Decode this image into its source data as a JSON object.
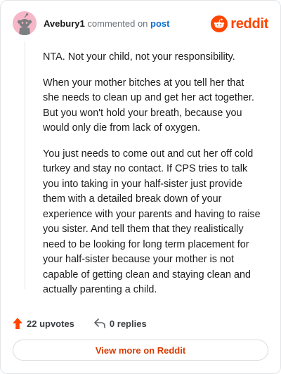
{
  "comment": {
    "author": "Avebury1",
    "action_text": "commented on",
    "target_link": "post",
    "paragraphs": [
      "NTA. Not your child, not your responsibility.",
      "When your mother bitches at you tell her that she needs to clean up and get her act together. But you won't hold your breath, because you would only die from lack of oxygen.",
      "You just needs to come out and cut her off cold turkey and stay no contact. If CPS tries to talk you into taking in your half-sister just provide them with a detailed break down of your experience with your parents and having to raise you sister. And tell them that they realistically need to be looking for long term placement for your half-sister because your mother is not capable of getting clean and staying clean and actually parenting a child."
    ]
  },
  "brand": {
    "wordmark": "reddit",
    "icon": "reddit-logo-icon",
    "color": "#ff4500"
  },
  "actions": {
    "upvotes_label": "22 upvotes",
    "upvote_icon": "upvote-arrow-icon",
    "replies_label": "0 replies",
    "reply_icon": "reply-arrow-icon"
  },
  "footer": {
    "view_more_label": "View more on Reddit"
  }
}
